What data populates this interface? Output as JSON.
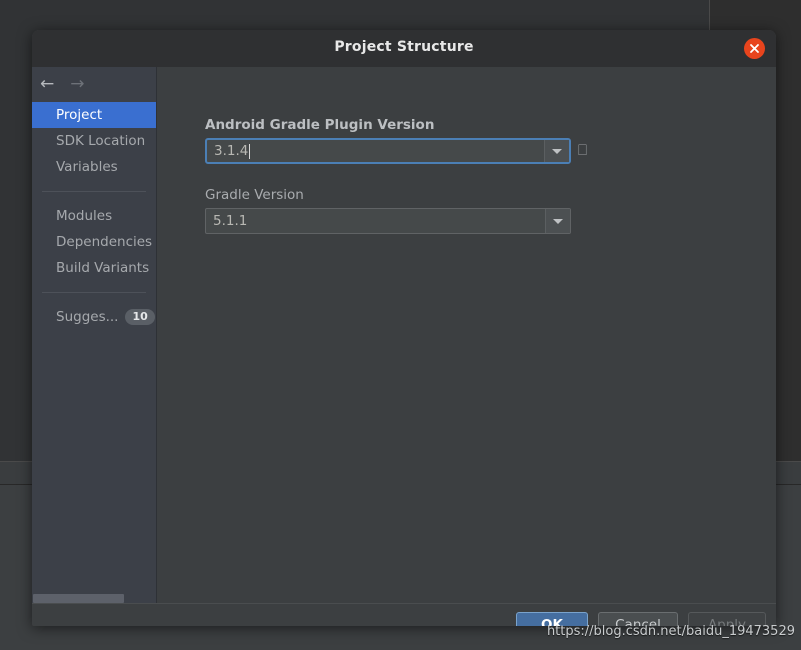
{
  "dialog": {
    "title": "Project Structure",
    "close_icon": "close-x-icon"
  },
  "nav": {
    "back_icon": "←",
    "forward_icon": "→"
  },
  "sidebar": {
    "groups": [
      {
        "items": [
          {
            "label": "Project",
            "selected": true
          },
          {
            "label": "SDK Location",
            "selected": false
          },
          {
            "label": "Variables",
            "selected": false
          }
        ]
      },
      {
        "items": [
          {
            "label": "Modules",
            "selected": false
          },
          {
            "label": "Dependencies",
            "selected": false
          },
          {
            "label": "Build Variants",
            "selected": false
          }
        ]
      },
      {
        "items": [
          {
            "label": "Sugges...",
            "selected": false,
            "badge": "10"
          }
        ]
      }
    ]
  },
  "content": {
    "fields": [
      {
        "label": "Android Gradle Plugin Version",
        "bold": true,
        "value": "3.1.4",
        "focused": true,
        "has_caret": true,
        "trailing_glyph": "⎕"
      },
      {
        "label": "Gradle Version",
        "bold": false,
        "value": "5.1.1",
        "focused": false,
        "has_caret": false
      }
    ]
  },
  "buttons": {
    "ok": "OK",
    "cancel": "Cancel",
    "apply": "Apply"
  },
  "watermark": "https://blog.csdn.net/baidu_19473529",
  "colors": {
    "accent_blue": "#3a6fd0",
    "ok_blue": "#456ea0",
    "focus_border": "#4b7fb5",
    "close_red": "#e8441d",
    "dialog_bg": "#3c3f41",
    "sidebar_bg": "#3c4048",
    "titlebar_bg": "#2f3032"
  }
}
